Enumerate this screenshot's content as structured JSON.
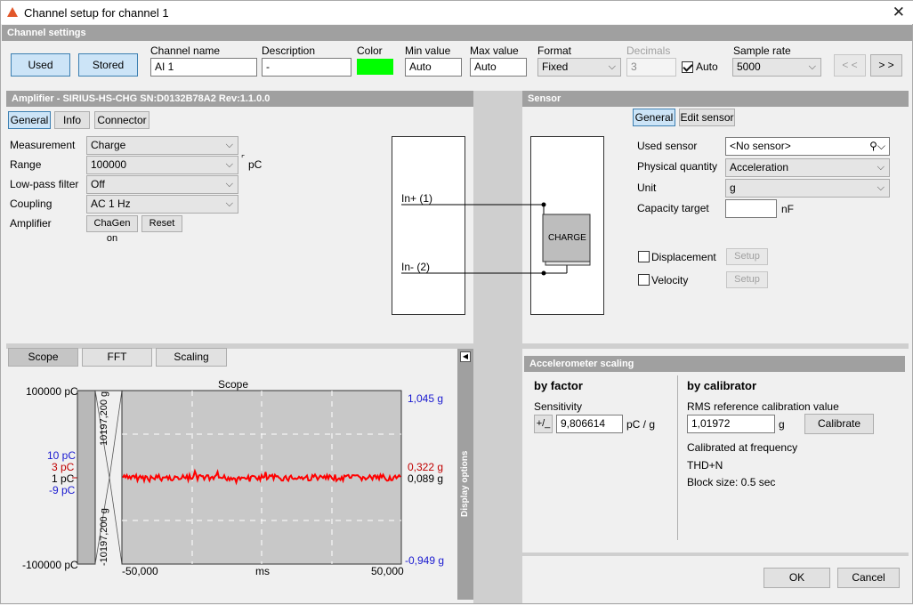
{
  "window": {
    "title": "Channel setup for channel 1"
  },
  "channel_settings": {
    "header": "Channel settings",
    "used_label": "Used",
    "stored_label": "Stored",
    "name_label": "Channel name",
    "name_value": "AI 1",
    "desc_label": "Description",
    "desc_value": "-",
    "color_label": "Color",
    "color_value": "#00ff00",
    "min_label": "Min value",
    "min_value": "Auto",
    "max_label": "Max value",
    "max_value": "Auto",
    "format_label": "Format",
    "format_value": "Fixed",
    "decimals_label": "Decimals",
    "decimals_value": "3",
    "auto_label": "Auto",
    "auto_checked": true,
    "rate_label": "Sample rate",
    "rate_value": "5000",
    "prev_label": "< <",
    "next_label": "> >"
  },
  "amplifier": {
    "header": "Amplifier - SIRIUS-HS-CHG  SN:D0132B78A2 Rev:1.1.0.0",
    "tabs": [
      "General",
      "Info",
      "Connector"
    ],
    "measurement_label": "Measurement",
    "measurement_value": "Charge",
    "range_label": "Range",
    "range_value": "100000",
    "range_unit": "pC",
    "lowpass_label": "Low-pass filter",
    "lowpass_value": "Off",
    "coupling_label": "Coupling",
    "coupling_value": "AC  1 Hz",
    "amplifier_label": "Amplifier",
    "chagen_label": "ChaGen on",
    "reset_label": "Reset",
    "in_plus": "In+ (1)",
    "in_minus": "In- (2)"
  },
  "sensor": {
    "header": "Sensor",
    "tabs": [
      "General",
      "Edit sensor"
    ],
    "used_sensor_label": "Used sensor",
    "used_sensor_value": "<No sensor>",
    "physical_label": "Physical quantity",
    "physical_value": "Acceleration",
    "unit_label": "Unit",
    "unit_value": "g",
    "capacity_label": "Capacity target",
    "capacity_value": "",
    "capacity_unit": "nF",
    "charge_label": "CHARGE",
    "displacement_label": "Displacement",
    "velocity_label": "Velocity",
    "setup_label": "Setup"
  },
  "scope": {
    "tabs": [
      "Scope",
      "FFT",
      "Scaling"
    ],
    "title": "Scope",
    "left_top": "100000 pC",
    "left_bottom": "-100000 pC",
    "left_10": "10 pC",
    "left_3": "3 pC",
    "left_1": "1 pC",
    "left_m9": "-9 pC",
    "bar_top": "10197,200 g",
    "bar_bottom": "-10197,200 g",
    "right_top": "1,045 g",
    "right_322": "0,322 g",
    "right_089": "0,089 g",
    "right_bottom": "-0,949 g",
    "x_min": "-50,000",
    "x_unit": "ms",
    "x_max": "50,000",
    "display_options": "Display options"
  },
  "accel_scaling": {
    "header": "Accelerometer scaling",
    "by_factor": "by factor",
    "sensitivity_label": "Sensitivity",
    "pm_label": "+/_",
    "sensitivity_value": "9,806614",
    "sensitivity_unit": "pC / g",
    "by_calibrator": "by calibrator",
    "rms_label": "RMS reference calibration value",
    "rms_value": "1,01972",
    "rms_unit": "g",
    "calibrate_label": "Calibrate",
    "calibrated_at": "Calibrated at frequency",
    "thd": "THD+N",
    "block_size": "Block size: 0.5 sec"
  },
  "footer": {
    "ok_label": "OK",
    "cancel_label": "Cancel"
  }
}
